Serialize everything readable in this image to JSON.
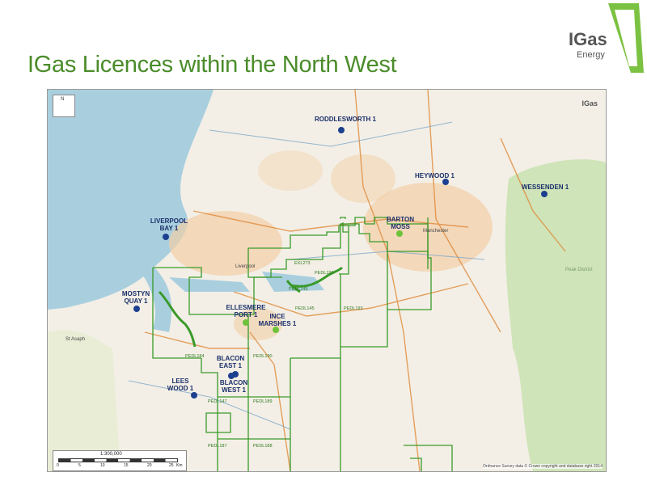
{
  "header": {
    "title": "IGas Licences within the North West"
  },
  "brand": {
    "name": "IGas",
    "tagline": "Energy",
    "green": "#7cc242"
  },
  "map": {
    "wells": [
      {
        "label": "RODDLESWORTH 1",
        "color": "#1d3f8f"
      },
      {
        "label": "HEYWOOD 1",
        "color": "#1d3f8f"
      },
      {
        "label": "WESSENDEN 1",
        "color": "#1d3f8f"
      },
      {
        "label": "LIVERPOOL BAY 1",
        "color": "#1d3f8f"
      },
      {
        "label": "BARTON MOSS",
        "color": "#6dc23a"
      },
      {
        "label": "MOSTYN QUAY 1",
        "color": "#1d3f8f"
      },
      {
        "label": "ELLESMERE PORT 1",
        "color": "#6dc23a"
      },
      {
        "label": "INCE MARSHES 1",
        "color": "#6dc23a"
      },
      {
        "label": "BLACON EAST 1",
        "color": "#1d3f8f"
      },
      {
        "label": "BLACON WEST 1",
        "color": "#1d3f8f"
      },
      {
        "label": "LEES WOOD 1",
        "color": "#1d3f8f"
      }
    ],
    "licences": [
      "EXL273",
      "PEDL145",
      "PEDL193",
      "PEDL184",
      "PEDL190",
      "PEDL147",
      "PEDL189",
      "PEDL187",
      "PEDL188",
      "PEDL193",
      "PEDL145"
    ],
    "places": {
      "liverpool": "Liverpool",
      "manchester": "Manchester",
      "st_asaph": "St Asaph",
      "peak": "Peak District"
    },
    "north": "N",
    "scale": {
      "ratio": "1:300,000",
      "ticks": [
        "0",
        "5",
        "10",
        "15",
        "20",
        "25"
      ],
      "unit": "Km"
    },
    "credit": "Ordnance Survey data © Crown copyright and database right 2014"
  }
}
